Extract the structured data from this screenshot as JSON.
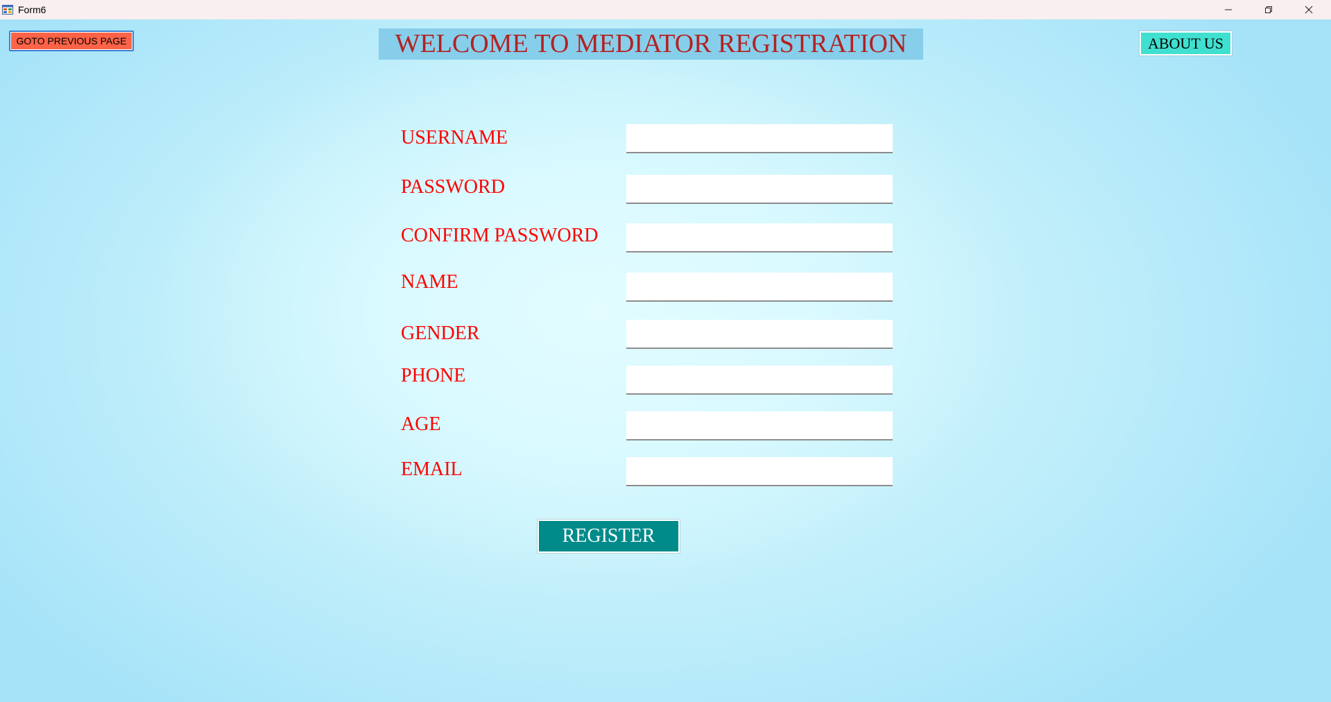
{
  "window": {
    "title": "Form6",
    "app_icon": "winforms-app-icon",
    "controls": {
      "minimize_icon": "minimize-icon",
      "maximize_icon": "restore-icon",
      "close_icon": "close-icon"
    }
  },
  "header": {
    "previous_button_label": "GOTO PREVIOUS PAGE",
    "welcome_title": "WELCOME TO MEDIATOR REGISTRATION",
    "about_button_label": "ABOUT US"
  },
  "form": {
    "fields": [
      {
        "label": "USERNAME",
        "value": ""
      },
      {
        "label": "PASSWORD",
        "value": ""
      },
      {
        "label": "CONFIRM PASSWORD",
        "value": ""
      },
      {
        "label": "NAME",
        "value": ""
      },
      {
        "label": "GENDER",
        "value": ""
      },
      {
        "label": "PHONE",
        "value": ""
      },
      {
        "label": "AGE",
        "value": ""
      },
      {
        "label": "EMAIL",
        "value": ""
      }
    ],
    "register_button_label": "REGISTER"
  },
  "colors": {
    "previous_button_bg": "#ff6347",
    "welcome_bg": "#87ceeb",
    "welcome_text": "#b22222",
    "about_button_bg": "#40e0d0",
    "label_text": "#ff0000",
    "register_button_bg": "#008b8b",
    "register_button_text": "#ffffff"
  }
}
